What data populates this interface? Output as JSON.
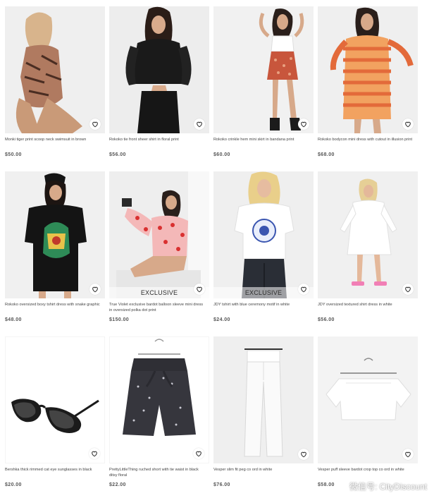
{
  "products": [
    {
      "title": "Monki tiger print scoop neck swimsuit in brown",
      "price": "$50.00",
      "badge": ""
    },
    {
      "title": "Rokoko tie front sheer shirt in floral print",
      "price": "$56.00",
      "badge": ""
    },
    {
      "title": "Rokoko crinkle hem mini skirt in bandana print",
      "price": "$60.00",
      "badge": ""
    },
    {
      "title": "Rokoko bodycon mini dress with cutout in illusion print",
      "price": "$68.00",
      "badge": ""
    },
    {
      "title": "Rokoko oversized boxy tshirt dress with snake graphic",
      "price": "$48.00",
      "badge": ""
    },
    {
      "title": "True Violet exclusive bardot balloon sleeve mini dress in oversized polka dot print",
      "price": "$150.00",
      "badge": "EXCLUSIVE"
    },
    {
      "title": "JDY tshirt with blue ceremony motif in white",
      "price": "$24.00",
      "badge": "EXCLUSIVE"
    },
    {
      "title": "JDY oversized textured shirt dress in white",
      "price": "$56.00",
      "badge": ""
    },
    {
      "title": "Bershka thick rimmed cat eye sunglasses in black",
      "price": "$20.00",
      "badge": ""
    },
    {
      "title": "PrettyLittleThing ruched short with tie waist in black ditsy floral",
      "price": "$22.00",
      "badge": ""
    },
    {
      "title": "Vesper slim fit peg co ord in white",
      "price": "$76.00",
      "badge": ""
    },
    {
      "title": "Vesper puff sleeve bardot crop top co ord in white",
      "price": "$58.00",
      "badge": ""
    }
  ],
  "watermark": "微信号: CityDiscount",
  "icons": {
    "wishlist": "heart-icon",
    "watermark": "wechat-icon"
  }
}
